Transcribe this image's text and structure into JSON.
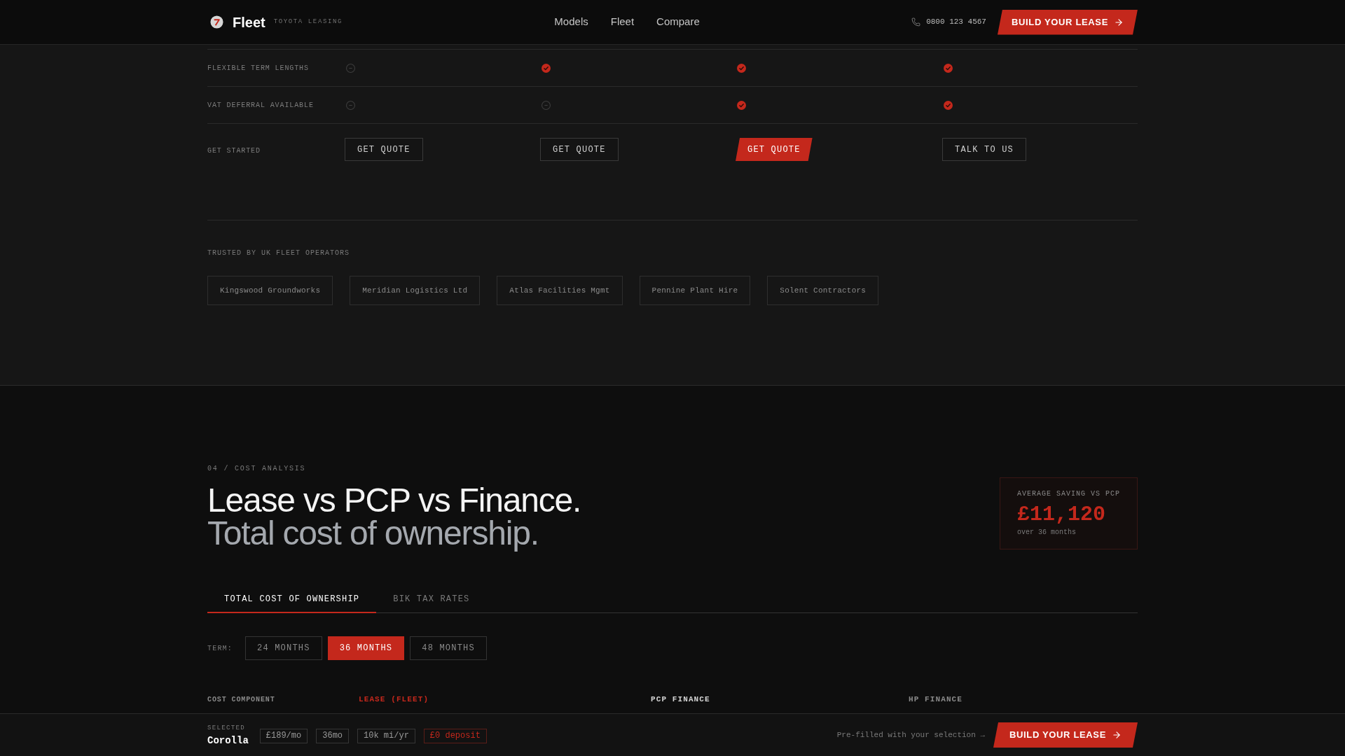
{
  "header": {
    "brand": "Fleet",
    "tagline": "TOYOTA LEASING",
    "nav": [
      "Models",
      "Fleet",
      "Compare"
    ],
    "phone": "0800 123 4567",
    "cta": "BUILD YOUR LEASE"
  },
  "comparison": {
    "rows": [
      {
        "label": "FLEXIBLE TERM LENGTHS",
        "cells": [
          {
            "included": false
          },
          {
            "included": true
          },
          {
            "included": true
          },
          {
            "included": true
          }
        ]
      },
      {
        "label": "VAT DEFERRAL AVAILABLE",
        "cells": [
          {
            "included": false
          },
          {
            "included": false
          },
          {
            "included": true
          },
          {
            "included": true
          }
        ]
      }
    ],
    "actions": {
      "label": "GET STARTED",
      "buttons": [
        {
          "label": "GET QUOTE",
          "primary": false
        },
        {
          "label": "GET QUOTE",
          "primary": false
        },
        {
          "label": "GET QUOTE",
          "primary": true
        },
        {
          "label": "TALK TO US",
          "primary": false
        }
      ]
    }
  },
  "trusted": {
    "title": "TRUSTED BY UK FLEET OPERATORS",
    "companies": [
      "Kingswood Groundworks",
      "Meridian Logistics Ltd",
      "Atlas Facilities Mgmt",
      "Pennine Plant Hire",
      "Solent Contractors"
    ]
  },
  "cost_analysis": {
    "eyebrow": "04 / COST ANALYSIS",
    "title": "Lease vs PCP vs Finance.",
    "subtitle": "Total cost of ownership.",
    "saving": {
      "label": "AVERAGE SAVING VS PCP",
      "value": "£11,120",
      "note": "over 36 months"
    },
    "tabs": [
      {
        "label": "TOTAL COST OF OWNERSHIP",
        "selected": true
      },
      {
        "label": "BIK TAX RATES",
        "selected": false
      }
    ],
    "term": {
      "label": "TERM:",
      "options": [
        {
          "label": "24 MONTHS",
          "selected": false
        },
        {
          "label": "36 MONTHS",
          "selected": true
        },
        {
          "label": "48 MONTHS",
          "selected": false
        }
      ]
    },
    "table": {
      "row_header": "COST COMPONENT",
      "columns": [
        {
          "label": "LEASE (FLEET)",
          "color": "#c4281c"
        },
        {
          "label": "PCP FINANCE",
          "color": "#d4d4d4"
        },
        {
          "label": "HP FINANCE",
          "color": "#8a8a8a"
        }
      ]
    }
  },
  "selection_bar": {
    "label": "SELECTED",
    "model": "Corolla",
    "chips": [
      {
        "text": "£189/mo",
        "highlight": false
      },
      {
        "text": "36mo",
        "highlight": false
      },
      {
        "text": "10k mi/yr",
        "highlight": false
      },
      {
        "text": "£0 deposit",
        "highlight": true
      }
    ],
    "note": "Pre-filled with your selection →",
    "cta": "BUILD YOUR LEASE"
  }
}
